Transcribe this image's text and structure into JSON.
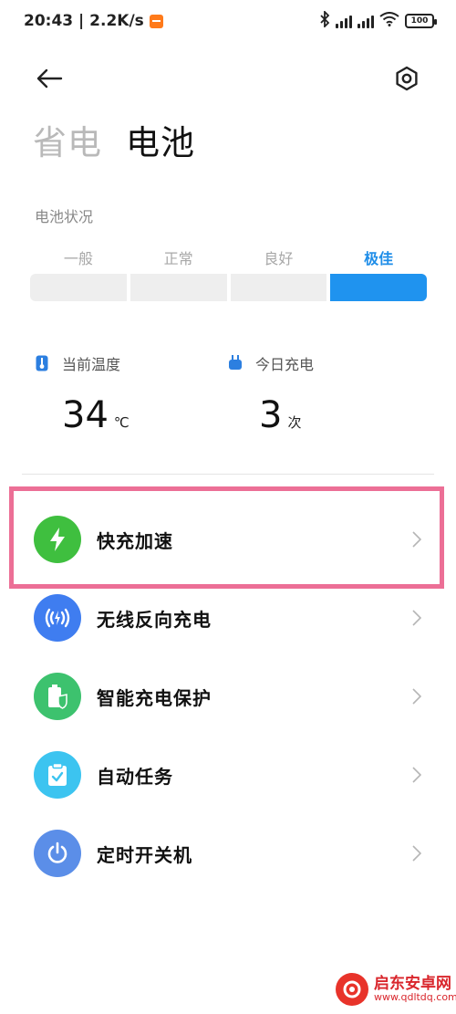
{
  "status_bar": {
    "time_speed": "20:43 | 2.2K/s",
    "battery": "100"
  },
  "header": {
    "tabs": [
      {
        "label": "省电",
        "active": false
      },
      {
        "label": "电池",
        "active": true
      }
    ]
  },
  "battery_status": {
    "label": "电池状况",
    "levels": [
      {
        "label": "一般",
        "active": false
      },
      {
        "label": "正常",
        "active": false
      },
      {
        "label": "良好",
        "active": false
      },
      {
        "label": "极佳",
        "active": true
      }
    ],
    "active_color": "#1f93ef"
  },
  "stats": {
    "temperature": {
      "label": "当前温度",
      "value": "34",
      "unit": "℃"
    },
    "charges": {
      "label": "今日充电",
      "value": "3",
      "unit": "次"
    }
  },
  "menu": {
    "items": [
      {
        "label": "快充加速",
        "icon": "lightning-icon",
        "color": "#3fbf3f"
      },
      {
        "label": "无线反向充电",
        "icon": "wireless-charge-icon",
        "color": "#3f7df0"
      },
      {
        "label": "智能充电保护",
        "icon": "battery-shield-icon",
        "color": "#3dc26e"
      },
      {
        "label": "自动任务",
        "icon": "clipboard-check-icon",
        "color": "#3cc4f0"
      },
      {
        "label": "定时开关机",
        "icon": "power-icon",
        "color": "#5b8ee8"
      }
    ]
  },
  "highlight_color": "#ec6f96",
  "watermark": {
    "title": "启东安卓网",
    "url": "www.qdltdq.com"
  }
}
